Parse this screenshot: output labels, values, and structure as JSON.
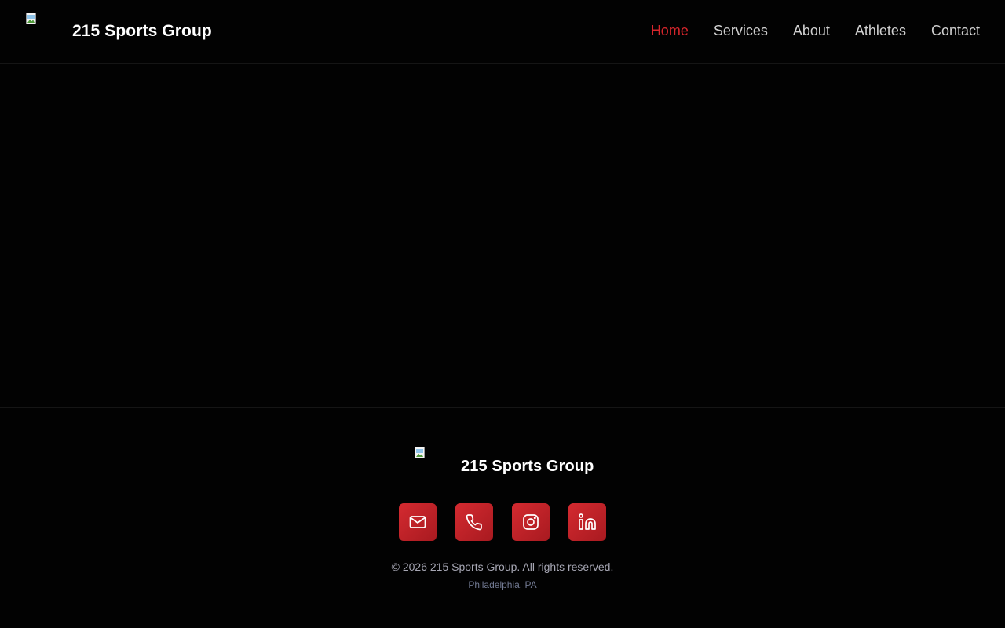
{
  "header": {
    "brand_name": "215 Sports Group",
    "logo_icon": "broken-image-icon",
    "nav": [
      {
        "label": "Home",
        "active": true
      },
      {
        "label": "Services",
        "active": false
      },
      {
        "label": "About",
        "active": false
      },
      {
        "label": "Athletes",
        "active": false
      },
      {
        "label": "Contact",
        "active": false
      }
    ]
  },
  "footer": {
    "brand_name": "215 Sports Group",
    "logo_icon": "broken-image-icon",
    "socials": [
      {
        "icon": "mail-icon"
      },
      {
        "icon": "phone-icon"
      },
      {
        "icon": "instagram-icon"
      },
      {
        "icon": "linkedin-icon"
      }
    ],
    "copyright": "© 2026 215 Sports Group. All rights reserved.",
    "location": "Philadelphia, PA"
  },
  "colors": {
    "background": "#020202",
    "accent": "#d8262c",
    "nav_text": "#d0d0d0",
    "muted_text": "#a7a7b4"
  }
}
